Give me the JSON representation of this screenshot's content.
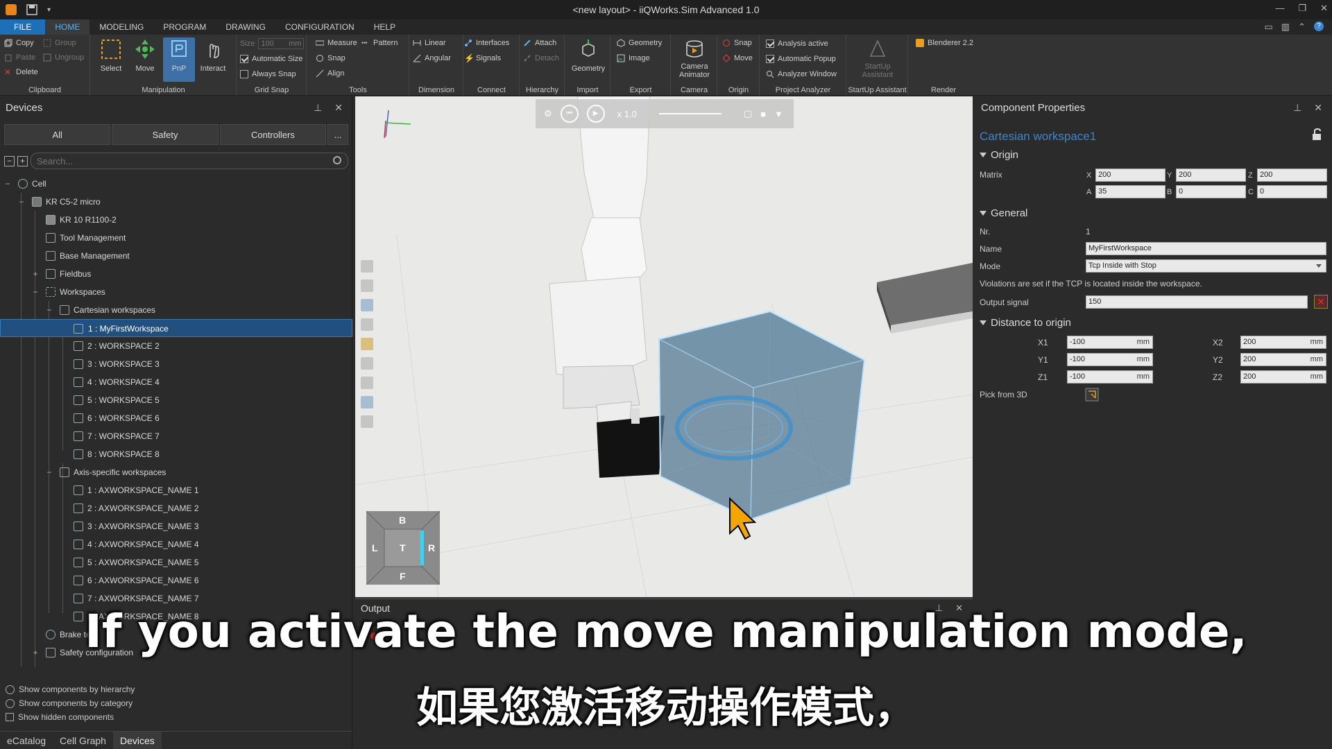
{
  "window": {
    "title": "<new layout> - iiQWorks.Sim Advanced 1.0"
  },
  "menu": [
    "FILE",
    "HOME",
    "MODELING",
    "PROGRAM",
    "DRAWING",
    "CONFIGURATION",
    "HELP"
  ],
  "ribbon": {
    "clipboard": {
      "label": "Clipboard",
      "copy": "Copy",
      "paste": "Paste",
      "delete": "Delete",
      "group": "Group",
      "ungroup": "Ungroup"
    },
    "manipulation": {
      "label": "Manipulation",
      "select": "Select",
      "move": "Move",
      "pnp": "PnP",
      "interact": "Interact"
    },
    "grid_snap": {
      "label": "Grid Snap",
      "size_label": "Size",
      "size_value": "100",
      "size_unit": "mm",
      "automatic_size": "Automatic Size",
      "always_snap": "Always Snap"
    },
    "tools": {
      "label": "Tools",
      "measure": "Measure",
      "pattern": "Pattern",
      "snap": "Snap",
      "align": "Align"
    },
    "dimension": {
      "label": "Dimension",
      "linear": "Linear",
      "angular": "Angular"
    },
    "connect": {
      "label": "Connect",
      "interfaces": "Interfaces",
      "signals": "Signals"
    },
    "hierarchy": {
      "label": "Hierarchy",
      "attach": "Attach",
      "detach": "Detach"
    },
    "import": {
      "label": "Import",
      "geometry": "Geometry"
    },
    "export": {
      "label": "Export",
      "geometry": "Geometry",
      "image": "Image"
    },
    "camera": {
      "label": "Camera",
      "animator": "Camera Animator"
    },
    "origin": {
      "label": "Origin",
      "snap": "Snap",
      "move": "Move"
    },
    "project_analyzer": {
      "label": "Project Analyzer",
      "analysis_active": "Analysis active",
      "automatic_popup": "Automatic Popup",
      "analyzer_window": "Analyzer Window"
    },
    "startup": {
      "label": "StartUp Assistant",
      "button": "StartUp Assistant"
    },
    "render": {
      "label": "Render",
      "blender": "Blenderer 2.2"
    }
  },
  "devices": {
    "title": "Devices",
    "tabs": [
      "All",
      "Safety",
      "Controllers",
      "..."
    ],
    "search_placeholder": "Search...",
    "tree": [
      {
        "label": "Cell"
      },
      {
        "label": "KR C5-2 micro"
      },
      {
        "label": "KR 10 R1100-2"
      },
      {
        "label": "Tool Management"
      },
      {
        "label": "Base Management"
      },
      {
        "label": "Fieldbus"
      },
      {
        "label": "Workspaces"
      },
      {
        "label": "Cartesian workspaces"
      },
      {
        "label": "1 : MyFirstWorkspace"
      },
      {
        "label": "2 : WORKSPACE 2"
      },
      {
        "label": "3 : WORKSPACE 3"
      },
      {
        "label": "4 : WORKSPACE 4"
      },
      {
        "label": "5 : WORKSPACE 5"
      },
      {
        "label": "6 : WORKSPACE 6"
      },
      {
        "label": "7 : WORKSPACE 7"
      },
      {
        "label": "8 : WORKSPACE 8"
      },
      {
        "label": "Axis-specific workspaces"
      },
      {
        "label": "1 : AXWORKSPACE_NAME 1"
      },
      {
        "label": "2 : AXWORKSPACE_NAME 2"
      },
      {
        "label": "3 : AXWORKSPACE_NAME 3"
      },
      {
        "label": "4 : AXWORKSPACE_NAME 4"
      },
      {
        "label": "5 : AXWORKSPACE_NAME 5"
      },
      {
        "label": "6 : AXWORKSPACE_NAME 6"
      },
      {
        "label": "7 : AXWORKSPACE_NAME 7"
      },
      {
        "label": "8 : AXWORKSPACE_NAME 8"
      },
      {
        "label": "Brake test"
      },
      {
        "label": "Safety configuration"
      }
    ],
    "options": [
      "Show components by hierarchy",
      "Show components by category",
      "Show hidden components"
    ],
    "bottom_tabs": [
      "eCatalog",
      "Cell Graph",
      "Devices"
    ]
  },
  "viewport": {
    "speed": "x 1.0",
    "navcube": {
      "top": "B",
      "left": "L",
      "center": "T",
      "right": "R",
      "bottom": "F"
    }
  },
  "output": {
    "title": "Output"
  },
  "properties": {
    "title": "Component Properties",
    "component": "Cartesian workspace1",
    "origin": {
      "label": "Origin",
      "matrix_label": "Matrix",
      "x": "200",
      "y": "200",
      "z": "200",
      "a": "35",
      "b": "0",
      "c": "0"
    },
    "general": {
      "label": "General",
      "nr_label": "Nr.",
      "nr": "1",
      "name_label": "Name",
      "name": "MyFirstWorkspace",
      "mode_label": "Mode",
      "mode": "Tcp Inside with Stop",
      "note": "Violations are set if the TCP is located inside the workspace.",
      "output_label": "Output signal",
      "output": "150"
    },
    "distance": {
      "label": "Distance to origin",
      "x1": "-100",
      "y1": "-100",
      "z1": "-100",
      "x2": "200",
      "y2": "200",
      "z2": "200",
      "unit": "mm",
      "pick_label": "Pick from 3D"
    }
  },
  "subtitles": {
    "en": "If you activate the move manipulation mode,",
    "zh": "如果您激活移动操作模式，"
  }
}
